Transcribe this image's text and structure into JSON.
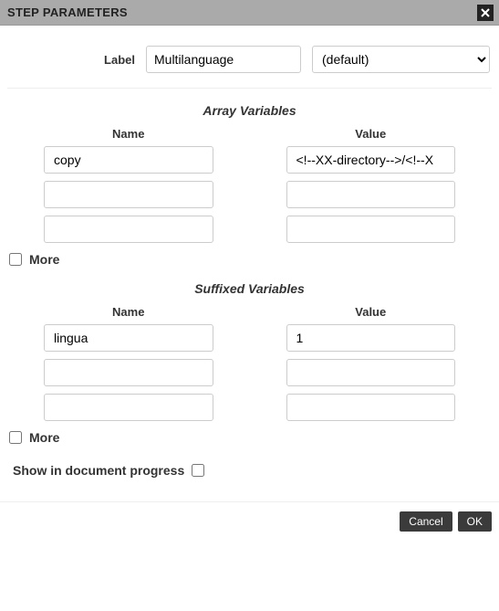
{
  "window": {
    "title": "STEP PARAMETERS"
  },
  "labelRow": {
    "label": "Label",
    "value": "Multilanguage",
    "dropdown": "(default)"
  },
  "arraySection": {
    "title": "Array Variables",
    "headers": {
      "name": "Name",
      "value": "Value"
    },
    "rows": [
      {
        "name": "copy",
        "value": "<!--XX-directory-->/<!--X"
      },
      {
        "name": "",
        "value": ""
      },
      {
        "name": "",
        "value": ""
      }
    ],
    "moreLabel": "More",
    "moreChecked": false
  },
  "suffixedSection": {
    "title": "Suffixed Variables",
    "headers": {
      "name": "Name",
      "value": "Value"
    },
    "rows": [
      {
        "name": "lingua",
        "value": "1"
      },
      {
        "name": "",
        "value": ""
      },
      {
        "name": "",
        "value": ""
      }
    ],
    "moreLabel": "More",
    "moreChecked": false
  },
  "docProgress": {
    "label": "Show in document progress",
    "checked": false
  },
  "footer": {
    "cancel": "Cancel",
    "ok": "OK"
  }
}
